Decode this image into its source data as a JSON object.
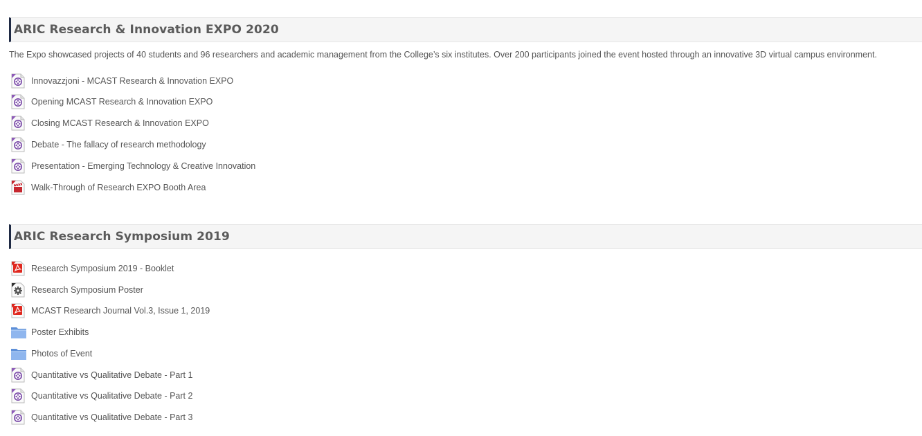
{
  "sections": [
    {
      "title": "ARIC Research & Innovation EXPO 2020",
      "summary": "The Expo showcased projects of 40 students and 96 researchers and academic management from the College’s six institutes. Over 200 participants joined the event hosted through an innovative 3D virtual campus environment.",
      "activities": [
        {
          "label": "Innovazzjoni - MCAST Research & Innovation EXPO",
          "icon": "video-file-icon"
        },
        {
          "label": "Opening MCAST Research & Innovation EXPO",
          "icon": "video-file-icon"
        },
        {
          "label": "Closing MCAST Research & Innovation EXPO",
          "icon": "video-file-icon"
        },
        {
          "label": "Debate - The fallacy of research methodology",
          "icon": "video-file-icon"
        },
        {
          "label": "Presentation - Emerging Technology & Creative Innovation",
          "icon": "video-file-icon"
        },
        {
          "label": "Walk-Through of Research EXPO Booth Area",
          "icon": "movie-clapper-icon"
        }
      ]
    },
    {
      "title": "ARIC Research Symposium 2019",
      "summary": "",
      "activities": [
        {
          "label": "Research Symposium 2019 - Booklet",
          "icon": "pdf-file-icon"
        },
        {
          "label": "Research Symposium Poster",
          "icon": "gear-file-icon"
        },
        {
          "label": "MCAST Research Journal Vol.3, Issue 1, 2019",
          "icon": "pdf-file-icon"
        },
        {
          "label": "Poster Exhibits",
          "icon": "folder-icon"
        },
        {
          "label": "Photos of Event",
          "icon": "folder-icon"
        },
        {
          "label": "Quantitative vs Qualitative Debate - Part 1",
          "icon": "video-file-icon"
        },
        {
          "label": "Quantitative vs Qualitative Debate - Part 2",
          "icon": "video-file-icon"
        },
        {
          "label": "Quantitative vs Qualitative Debate - Part 3",
          "icon": "video-file-icon"
        }
      ]
    }
  ]
}
